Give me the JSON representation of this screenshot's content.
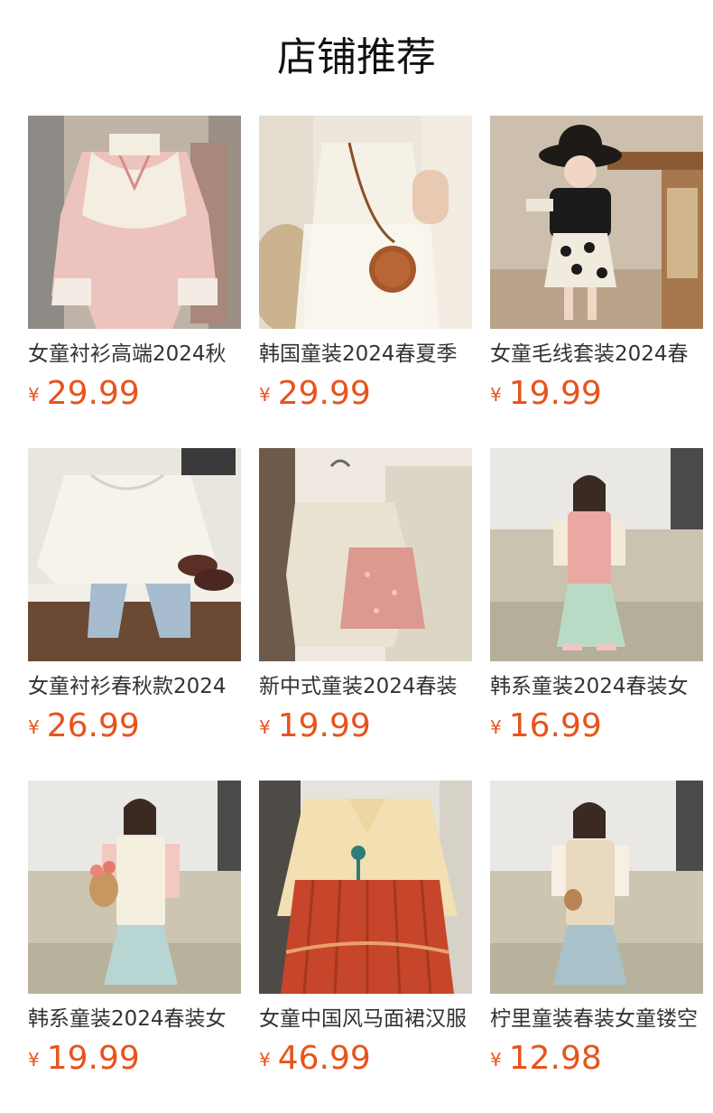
{
  "section_title": "店铺推荐",
  "currency_symbol": "¥",
  "products": [
    {
      "name": "女童衬衫高端2024秋",
      "price": "29.99",
      "scene": "pink-blouse"
    },
    {
      "name": "韩国童装2024春夏季",
      "price": "29.99",
      "scene": "fringe-vest-bag"
    },
    {
      "name": "女童毛线套装2024春",
      "price": "19.99",
      "scene": "girl-hat-flower-skirt"
    },
    {
      "name": "女童衬衫春秋款2024",
      "price": "26.99",
      "scene": "white-blouse-jeans"
    },
    {
      "name": "新中式童装2024春装",
      "price": "19.99",
      "scene": "sequin-set"
    },
    {
      "name": "韩系童装2024春装女",
      "price": "16.99",
      "scene": "girl-pink-vest-sofa"
    },
    {
      "name": "韩系童装2024春装女",
      "price": "19.99",
      "scene": "girl-lace-vest-sofa"
    },
    {
      "name": "女童中国风马面裙汉服",
      "price": "46.99",
      "scene": "mamian-skirt"
    },
    {
      "name": "柠里童装春装女童镂空",
      "price": "12.98",
      "scene": "girl-knit-vest-sofa"
    }
  ],
  "colors": {
    "price": "#e8531c",
    "title": "#111111"
  }
}
